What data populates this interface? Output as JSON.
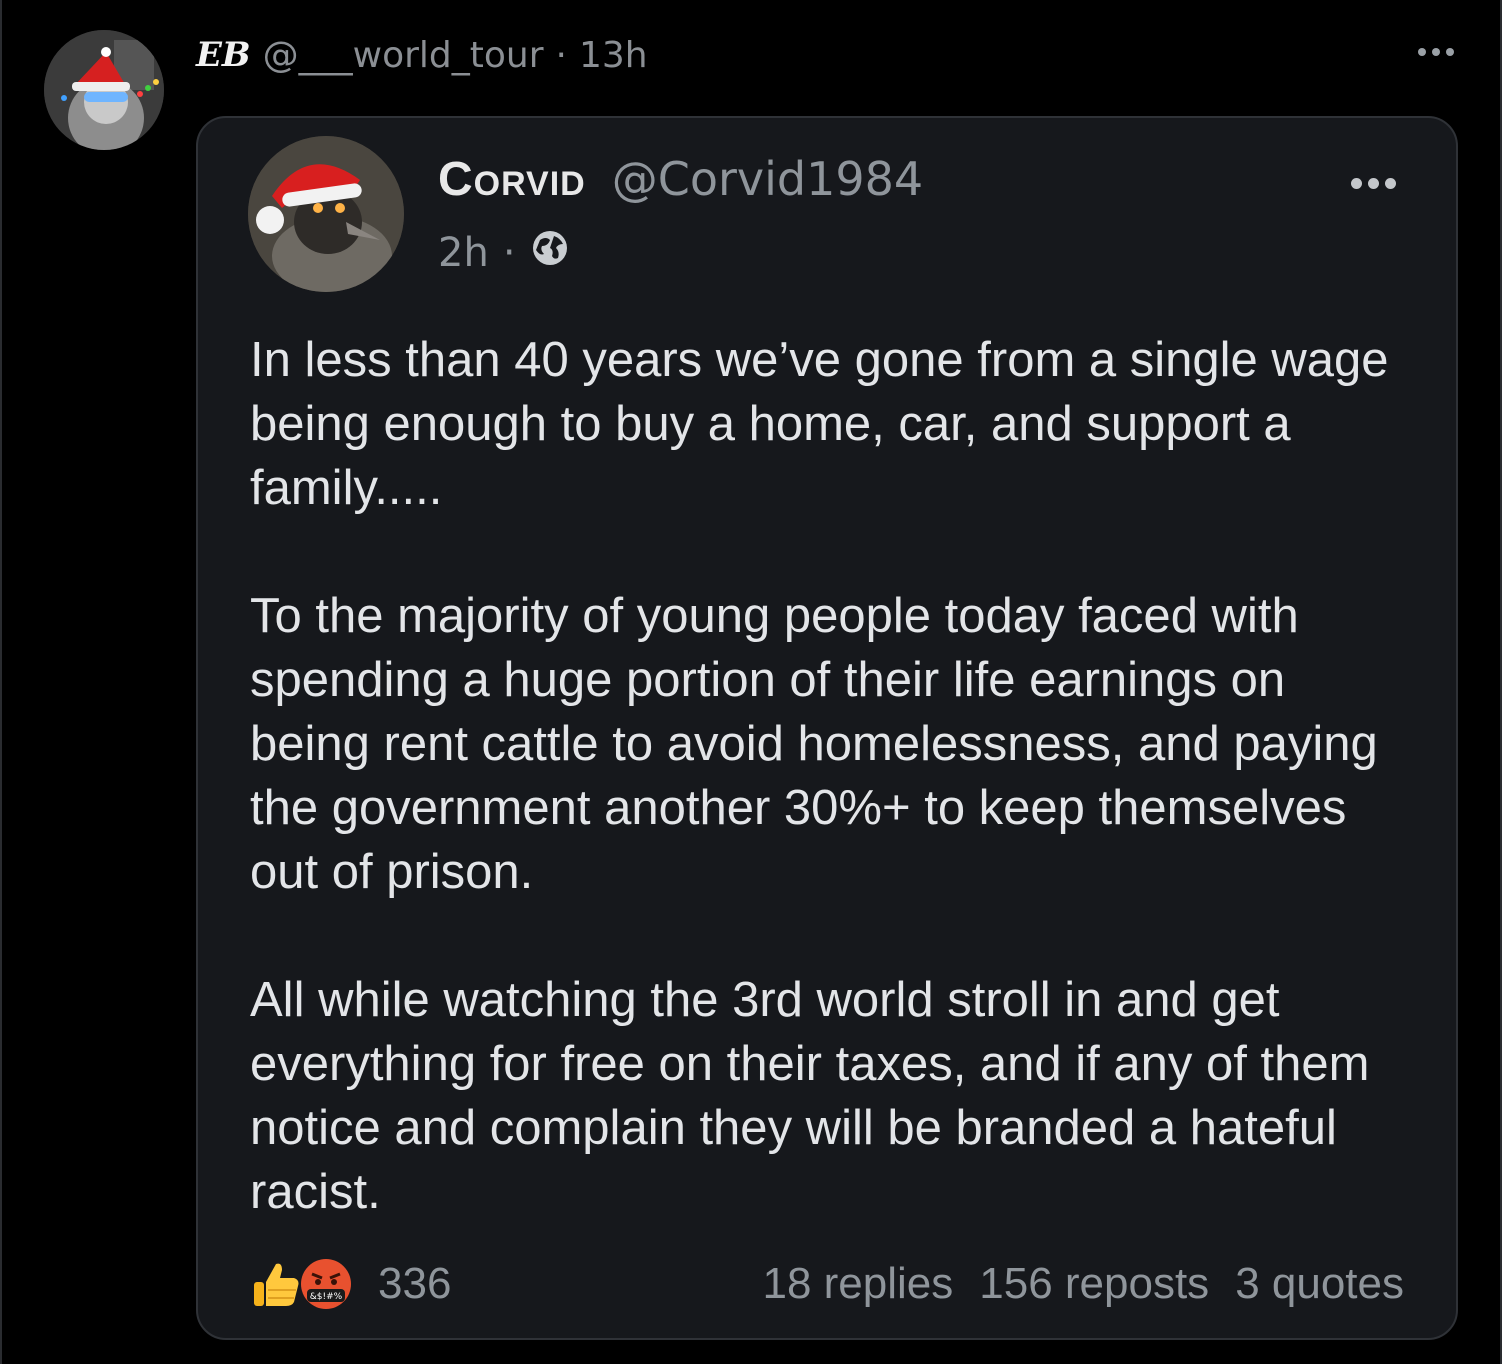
{
  "outer_post": {
    "author_name": "EB",
    "handle": "@___world_tour",
    "separator": "·",
    "time": "13h",
    "avatar_icon": "christmas-hat-avatar-icon",
    "more_icon": "more-options-icon"
  },
  "quoted_post": {
    "author_name": "Corvid",
    "handle": "@Corvid1984",
    "time": "2h",
    "separator": "·",
    "visibility_icon": "globe-icon",
    "more_icon": "more-options-icon",
    "paragraphs": [
      "In less than 40 years we’ve gone from a single wage being enough to buy a home, car, and support a family.....",
      "To the majority of young people today faced with spending a huge portion of their life earnings on being rent cattle to avoid homelessness, and paying the government another 30%+ to keep themselves out of prison.",
      "All while watching the 3rd world stroll in and get everything for free on their taxes, and if any of them notice and complain they will be branded a hateful racist."
    ],
    "reactions": {
      "icons": [
        "thumbs-up-icon",
        "angry-face-icon"
      ],
      "count": "336"
    },
    "stats": {
      "replies": "18 replies",
      "reposts": "156 reposts",
      "quotes": "3 quotes"
    }
  },
  "colors": {
    "background": "#000000",
    "card_background": "#16181c",
    "card_border": "#2f3237",
    "muted_text": "#8f959b",
    "body_text": "#e3e5e8"
  }
}
